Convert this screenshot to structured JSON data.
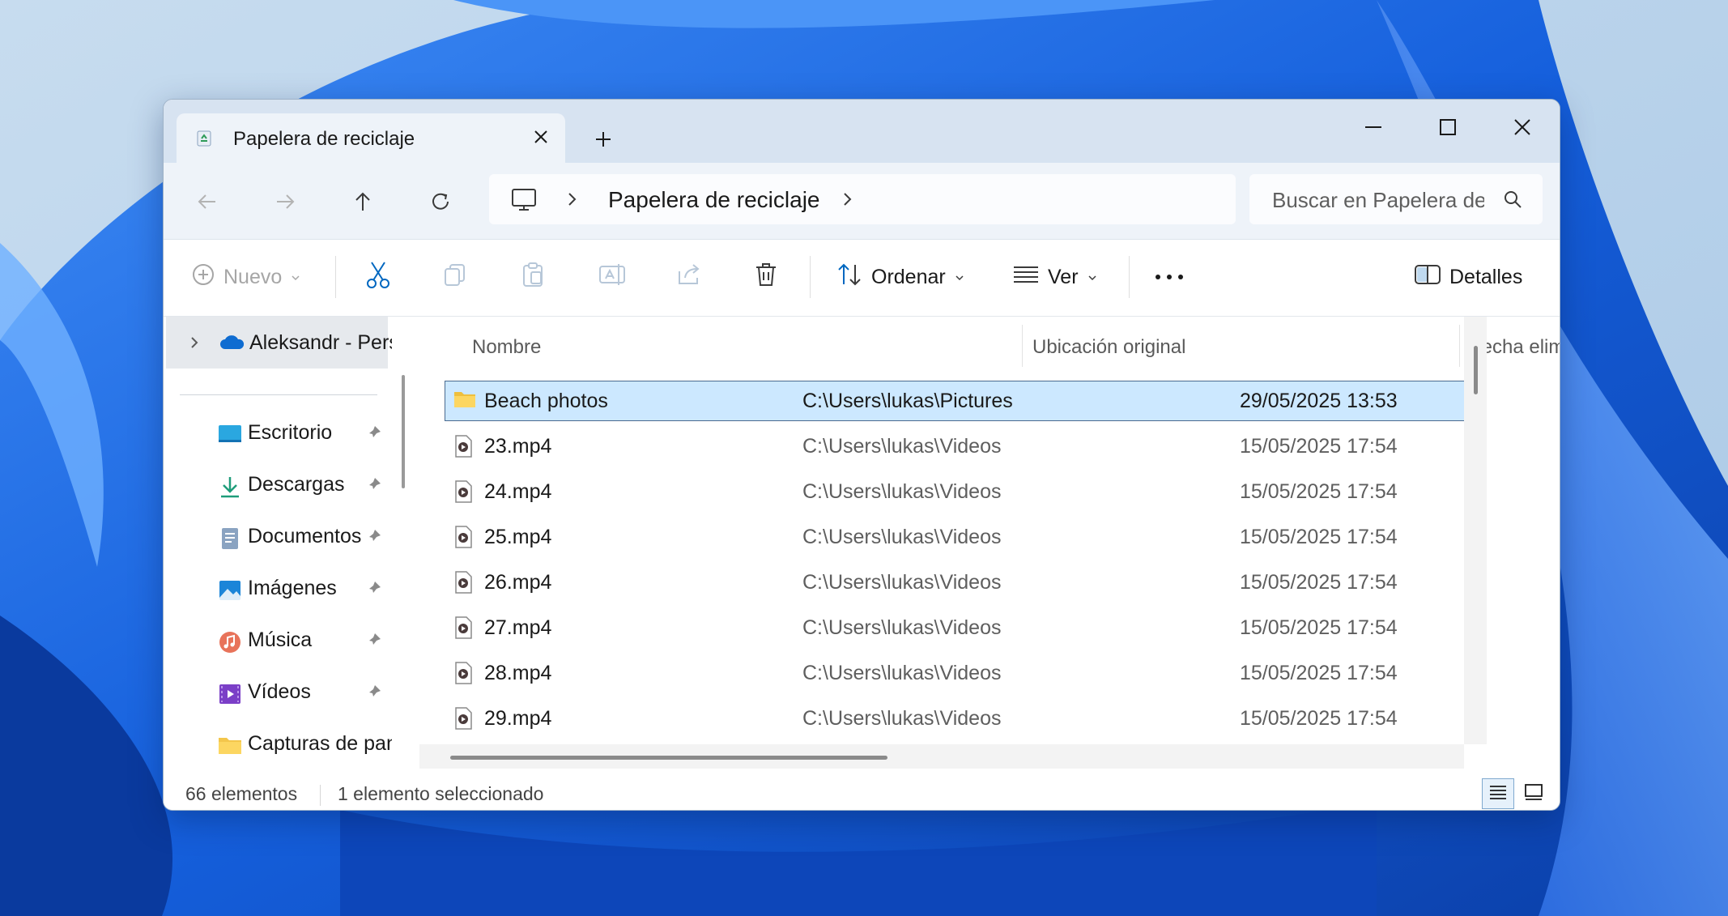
{
  "colors": {
    "accent": "#0067c0",
    "selection": "#cce8ff",
    "titlebar": "#d7e3f1",
    "wallpaper": "#1a5fd8"
  },
  "tab": {
    "title": "Papelera de reciclaje",
    "icon": "recycle-bin-icon"
  },
  "address": {
    "crumb": "Papelera de reciclaje"
  },
  "search": {
    "placeholder": "Buscar en Papelera de reciclaje"
  },
  "toolbar": {
    "new_label": "Nuevo",
    "sort_label": "Ordenar",
    "view_label": "Ver",
    "details_label": "Detalles"
  },
  "sidebar": {
    "onedrive": "Aleksandr - Personal",
    "items": [
      {
        "label": "Escritorio",
        "icon": "desktop-icon"
      },
      {
        "label": "Descargas",
        "icon": "downloads-icon"
      },
      {
        "label": "Documentos",
        "icon": "documents-icon"
      },
      {
        "label": "Imágenes",
        "icon": "pictures-icon"
      },
      {
        "label": "Música",
        "icon": "music-icon"
      },
      {
        "label": "Vídeos",
        "icon": "videos-icon"
      },
      {
        "label": "Capturas de pantalla",
        "icon": "folder-icon"
      }
    ]
  },
  "columns": {
    "name": "Nombre",
    "location": "Ubicación original",
    "date": "Fecha eliminación"
  },
  "files": [
    {
      "name": "Beach photos",
      "location": "C:\\Users\\lukas\\Pictures",
      "date": "29/05/2025 13:53",
      "type": "folder",
      "selected": true
    },
    {
      "name": "23.mp4",
      "location": "C:\\Users\\lukas\\Videos",
      "date": "15/05/2025 17:54",
      "type": "video"
    },
    {
      "name": "24.mp4",
      "location": "C:\\Users\\lukas\\Videos",
      "date": "15/05/2025 17:54",
      "type": "video"
    },
    {
      "name": "25.mp4",
      "location": "C:\\Users\\lukas\\Videos",
      "date": "15/05/2025 17:54",
      "type": "video"
    },
    {
      "name": "26.mp4",
      "location": "C:\\Users\\lukas\\Videos",
      "date": "15/05/2025 17:54",
      "type": "video"
    },
    {
      "name": "27.mp4",
      "location": "C:\\Users\\lukas\\Videos",
      "date": "15/05/2025 17:54",
      "type": "video"
    },
    {
      "name": "28.mp4",
      "location": "C:\\Users\\lukas\\Videos",
      "date": "15/05/2025 17:54",
      "type": "video"
    },
    {
      "name": "29.mp4",
      "location": "C:\\Users\\lukas\\Videos",
      "date": "15/05/2025 17:54",
      "type": "video"
    }
  ],
  "status": {
    "count": "66 elementos",
    "selected": "1 elemento seleccionado"
  }
}
